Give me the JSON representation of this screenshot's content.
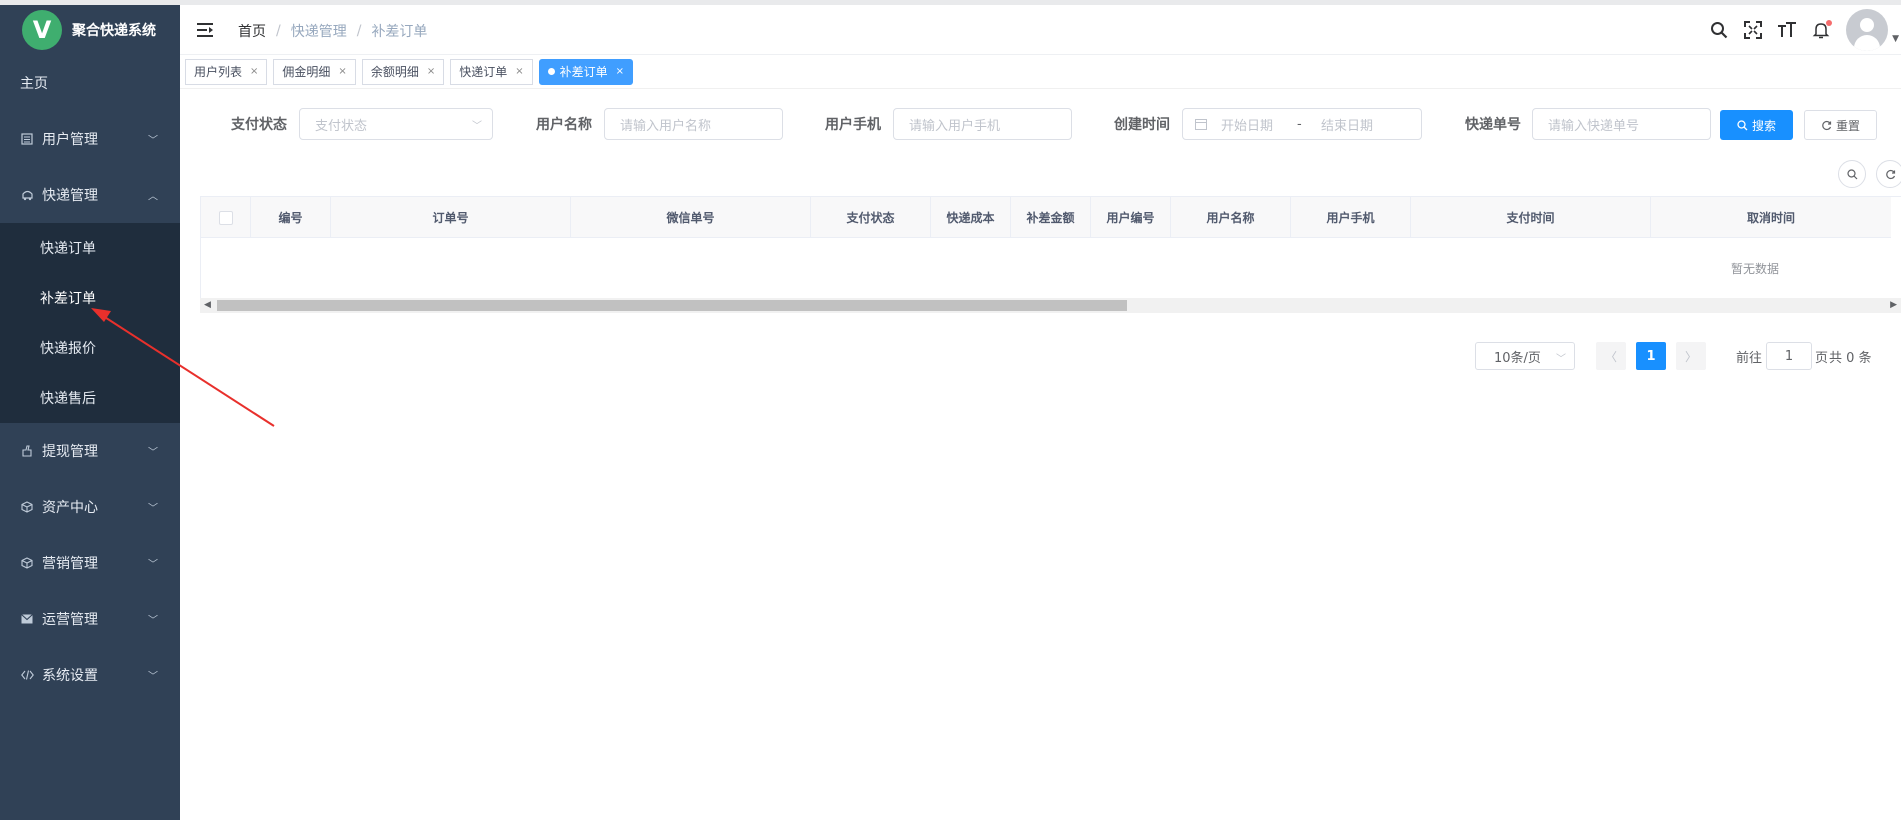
{
  "app": {
    "logo_letter": "V",
    "title": "聚合快递系统"
  },
  "sidebar": {
    "items": [
      {
        "label": "主页",
        "icon": ""
      },
      {
        "label": "用户管理",
        "icon": "list-icon",
        "arrow": "﹀"
      },
      {
        "label": "快递管理",
        "icon": "truck-icon",
        "arrow": "︿",
        "children": [
          {
            "label": "快递订单"
          },
          {
            "label": "补差订单",
            "active": true
          },
          {
            "label": "快递报价"
          },
          {
            "label": "快递售后"
          }
        ]
      },
      {
        "label": "提现管理",
        "icon": "withdraw-icon",
        "arrow": "﹀"
      },
      {
        "label": "资产中心",
        "icon": "box-icon",
        "arrow": "﹀"
      },
      {
        "label": "营销管理",
        "icon": "box-icon",
        "arrow": "﹀"
      },
      {
        "label": "运营管理",
        "icon": "mail-icon",
        "arrow": "﹀"
      },
      {
        "label": "系统设置",
        "icon": "code-icon",
        "arrow": "﹀"
      }
    ]
  },
  "breadcrumb": {
    "home": "首页",
    "parent": "快递管理",
    "current": "补差订单",
    "sep": "/"
  },
  "tags": [
    {
      "label": "用户列表"
    },
    {
      "label": "佣金明细"
    },
    {
      "label": "余额明细"
    },
    {
      "label": "快递订单"
    },
    {
      "label": "补差订单",
      "active": true
    }
  ],
  "tag_close": "×",
  "form": {
    "pay_status_label": "支付状态",
    "pay_status_placeholder": "支付状态",
    "user_name_label": "用户名称",
    "user_name_placeholder": "请输入用户名称",
    "user_phone_label": "用户手机",
    "user_phone_placeholder": "请输入用户手机",
    "created_label": "创建时间",
    "start_placeholder": "开始日期",
    "range_sep": "-",
    "end_placeholder": "结束日期",
    "express_no_label": "快递单号",
    "express_no_placeholder": "请输入快递单号",
    "search_button": "搜索",
    "reset_button": "重置"
  },
  "table": {
    "columns": [
      "编号",
      "订单号",
      "微信单号",
      "支付状态",
      "快递成本",
      "补差金额",
      "用户编号",
      "用户名称",
      "用户手机",
      "支付时间",
      "取消时间"
    ],
    "empty_text": "暂无数据"
  },
  "pagination": {
    "page_size": "10条/页",
    "current_page": "1",
    "goto_prefix": "前往",
    "goto_value": "1",
    "goto_suffix": "页",
    "total_text": "共 0 条"
  },
  "colors": {
    "sidebar_bg": "#304156",
    "submenu_bg": "#1f2d3d",
    "primary": "#1890ff",
    "annotation": "#e8302c"
  }
}
